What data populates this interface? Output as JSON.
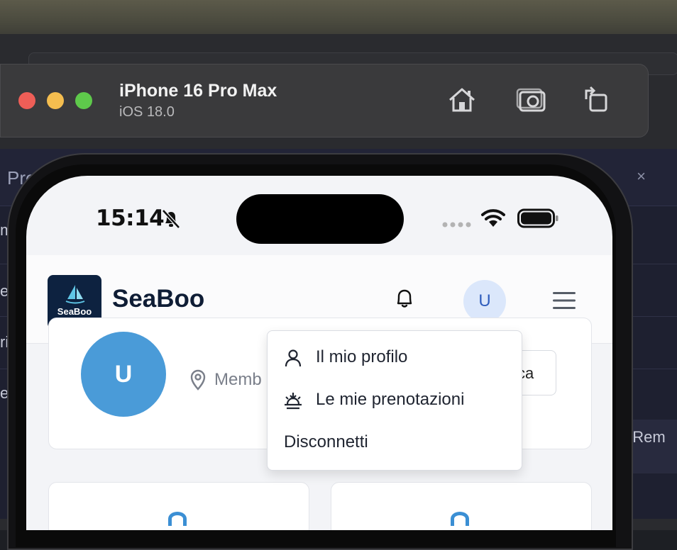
{
  "simulator": {
    "device_name": "iPhone 16 Pro Max",
    "os_version": "iOS 18.0",
    "toolbar_icons": [
      "home-icon",
      "screenshot-icon",
      "rotate-icon"
    ]
  },
  "background_editor": {
    "preview_label": "Preview",
    "side_fragments": [
      "m",
      "em",
      "rig",
      "e c"
    ],
    "right_fragment": "with Rem",
    "close_symbol": "×"
  },
  "status_bar": {
    "time": "15:14",
    "icons": [
      "bell-slash-icon",
      "signal-dots-icon",
      "wifi-icon",
      "battery-icon"
    ]
  },
  "app_header": {
    "logo_text": "SeaBoo",
    "brand_name": "SeaBoo",
    "avatar_initial": "U",
    "icons": [
      "bell-icon",
      "hamburger-menu-icon"
    ]
  },
  "profile_card": {
    "avatar_initial": "U",
    "location_text": "Memb",
    "button_text": "ca"
  },
  "dropdown_menu": {
    "items": [
      {
        "label": "Il mio profilo",
        "icon": "user-icon"
      },
      {
        "label": "Le mie prenotazioni",
        "icon": "sunset-boat-icon"
      },
      {
        "label": "Disconnetti",
        "icon": ""
      }
    ]
  },
  "colors": {
    "brand_dark": "#0d2240",
    "accent_blue": "#4a9bd8",
    "avatar_bg": "#dbe7fb"
  }
}
